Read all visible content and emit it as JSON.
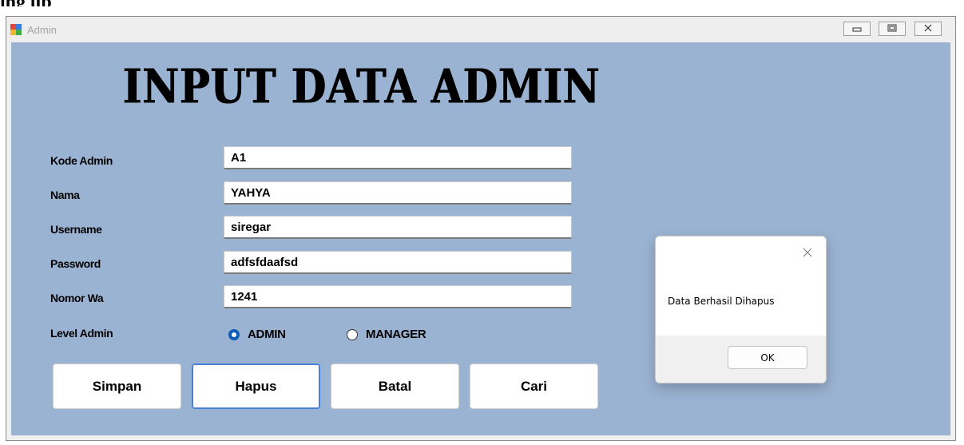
{
  "page_heading": "ing up",
  "window": {
    "title": "Admin",
    "controls": [
      "minimize",
      "maximize",
      "close"
    ]
  },
  "form": {
    "heading": "INPUT DATA ADMIN",
    "fields": [
      {
        "label": "Kode Admin",
        "value": "A1"
      },
      {
        "label": "Nama",
        "value": "YAHYA"
      },
      {
        "label": "Username",
        "value": "siregar"
      },
      {
        "label": "Password",
        "value": "adfsfdaafsd"
      },
      {
        "label": "Nomor Wa",
        "value": "1241"
      }
    ],
    "level_label": "Level Admin",
    "level_options": [
      {
        "label": "ADMIN",
        "selected": true
      },
      {
        "label": "MANAGER",
        "selected": false
      }
    ],
    "buttons": {
      "simpan": "Simpan",
      "hapus": "Hapus",
      "batal": "Batal",
      "cari": "Cari"
    }
  },
  "message_box": {
    "text": "Data Berhasil Dihapus",
    "ok_label": "OK"
  },
  "colors": {
    "client_background": "#9bb3d2",
    "radio_accent": "#0f5bb8",
    "focus_border": "#4a7fd6"
  }
}
